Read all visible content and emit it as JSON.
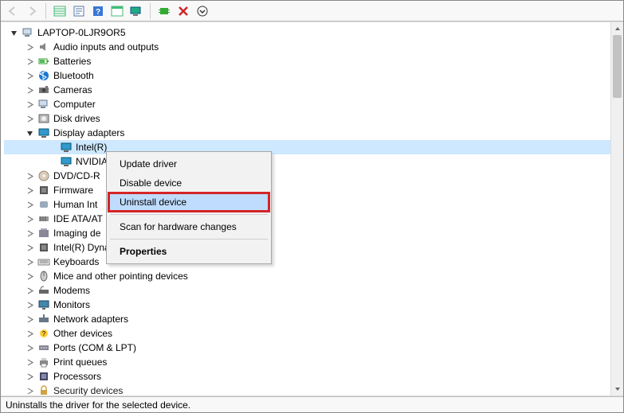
{
  "toolbar": {
    "back": "back-icon",
    "forward": "forward-icon",
    "show_hidden": "show-hidden-icon",
    "properties": "properties-icon",
    "help": "help-icon",
    "action": "action-icon",
    "scan": "scan-hardware-icon",
    "add_legacy": "add-legacy-icon",
    "remove": "remove-icon",
    "down": "down-icon"
  },
  "root": {
    "label": "LAPTOP-0LJR9OR5"
  },
  "categories": [
    {
      "id": "audio",
      "label": "Audio inputs and outputs",
      "icon": "speaker",
      "expandable": true
    },
    {
      "id": "batteries",
      "label": "Batteries",
      "icon": "battery",
      "expandable": true
    },
    {
      "id": "bluetooth",
      "label": "Bluetooth",
      "icon": "bluetooth",
      "expandable": true
    },
    {
      "id": "cameras",
      "label": "Cameras",
      "icon": "camera",
      "expandable": true
    },
    {
      "id": "computer",
      "label": "Computer",
      "icon": "computer",
      "expandable": true
    },
    {
      "id": "disk",
      "label": "Disk drives",
      "icon": "disk",
      "expandable": true
    },
    {
      "id": "display",
      "label": "Display adapters",
      "icon": "display",
      "expandable": true,
      "expanded": true,
      "children": [
        {
          "id": "intel",
          "label": "Intel(R)",
          "icon": "display",
          "selected": true
        },
        {
          "id": "nvidia",
          "label": "NVIDIA",
          "icon": "display"
        }
      ]
    },
    {
      "id": "dvd",
      "label": "DVD/CD-R",
      "icon": "dvd",
      "expandable": true,
      "truncated": true
    },
    {
      "id": "firmware",
      "label": "Firmware",
      "icon": "chip",
      "expandable": true
    },
    {
      "id": "hid",
      "label": "Human Int",
      "icon": "hid",
      "expandable": true,
      "truncated": true
    },
    {
      "id": "ide",
      "label": "IDE ATA/AT",
      "icon": "ide",
      "expandable": true,
      "truncated": true
    },
    {
      "id": "imaging",
      "label": "Imaging de",
      "icon": "imaging",
      "expandable": true,
      "truncated": true
    },
    {
      "id": "dptf",
      "label": "Intel(R) Dynamic Platform and Thermal Framework",
      "icon": "chip",
      "expandable": true
    },
    {
      "id": "keyboards",
      "label": "Keyboards",
      "icon": "keyboard",
      "expandable": true
    },
    {
      "id": "mice",
      "label": "Mice and other pointing devices",
      "icon": "mouse",
      "expandable": true
    },
    {
      "id": "modems",
      "label": "Modems",
      "icon": "modem",
      "expandable": true
    },
    {
      "id": "monitors",
      "label": "Monitors",
      "icon": "monitor",
      "expandable": true
    },
    {
      "id": "network",
      "label": "Network adapters",
      "icon": "network",
      "expandable": true
    },
    {
      "id": "other",
      "label": "Other devices",
      "icon": "other",
      "expandable": true
    },
    {
      "id": "ports",
      "label": "Ports (COM & LPT)",
      "icon": "port",
      "expandable": true
    },
    {
      "id": "printq",
      "label": "Print queues",
      "icon": "printer",
      "expandable": true
    },
    {
      "id": "processors",
      "label": "Processors",
      "icon": "cpu",
      "expandable": true
    },
    {
      "id": "security",
      "label": "Security devices",
      "icon": "security",
      "expandable": true,
      "cut": true
    }
  ],
  "context_menu": {
    "items": [
      {
        "label": "Update driver"
      },
      {
        "label": "Disable device"
      },
      {
        "label": "Uninstall device",
        "hover": true,
        "highlighted": true
      },
      {
        "separator": true
      },
      {
        "label": "Scan for hardware changes"
      },
      {
        "separator": true
      },
      {
        "label": "Properties",
        "bold": true
      }
    ]
  },
  "status_text": "Uninstalls the driver for the selected device."
}
